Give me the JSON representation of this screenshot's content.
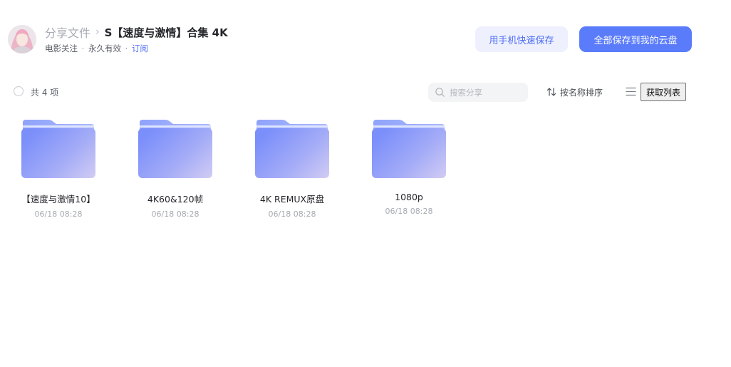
{
  "header": {
    "breadcrumb_root": "分享文件",
    "breadcrumb_separator": "›",
    "share_title": "S【速度与激情】合集 4K",
    "meta": {
      "tag": "电影关注",
      "separator": "·",
      "validity": "永久有效",
      "subscribe": "订阅"
    },
    "buttons": {
      "phone_save": "用手机快速保存",
      "save_all": "全部保存到我的云盘"
    }
  },
  "toolbar": {
    "count_label": "共 4 项",
    "search_placeholder": "搜索分享",
    "sort_label": "按名称排序",
    "fetch_list_label": "获取列表"
  },
  "files": [
    {
      "name": "【速度与激情10】",
      "date": "06/18 08:28",
      "icon": "folder-icon"
    },
    {
      "name": "4K60&120帧",
      "date": "06/18 08:28",
      "icon": "folder-icon"
    },
    {
      "name": "4K REMUX原盘",
      "date": "06/18 08:28",
      "icon": "folder-icon"
    },
    {
      "name": "1080p",
      "date": "06/18 08:28",
      "icon": "folder-icon"
    }
  ],
  "colors": {
    "accent": "#5b7cfa",
    "accent_light": "#eef0fe",
    "link": "#4e6ef2",
    "folder_dark": "#7b8ffb",
    "folder_light": "#cfcbf5"
  }
}
